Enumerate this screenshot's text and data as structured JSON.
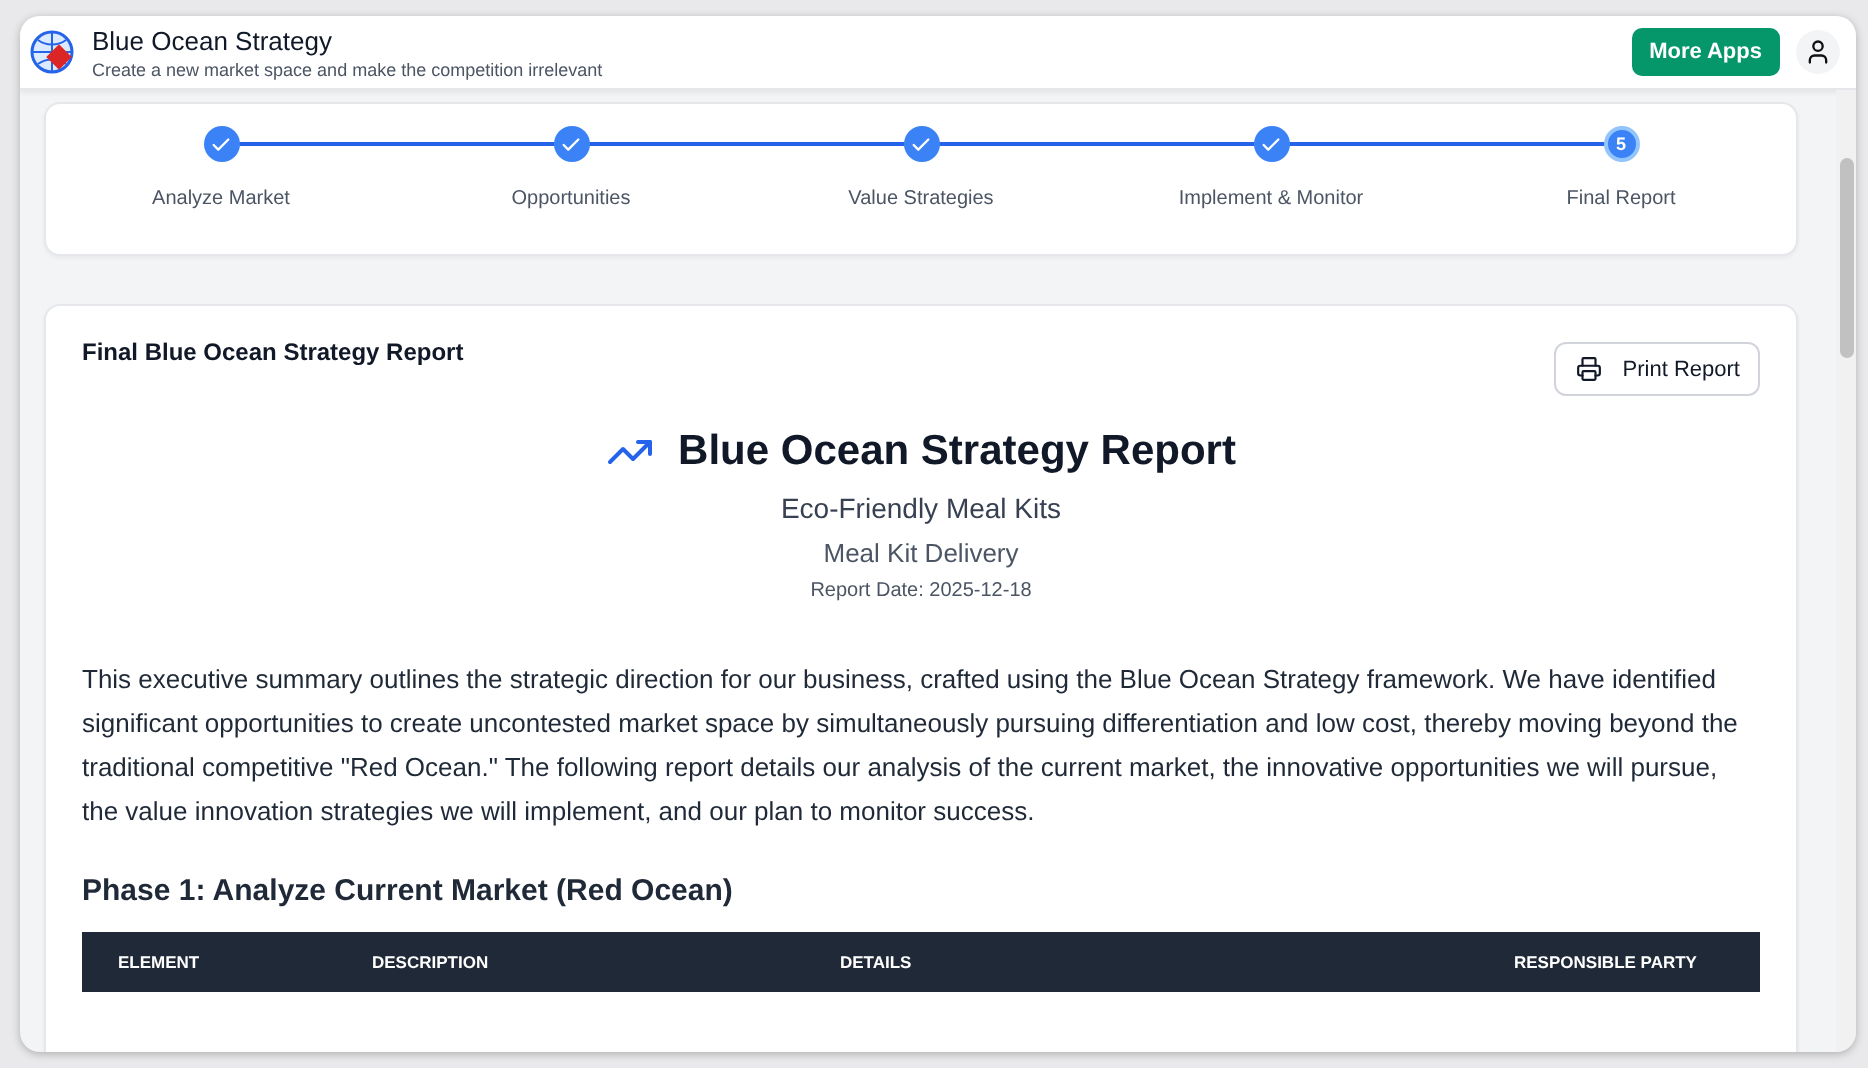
{
  "app": {
    "title": "Blue Ocean Strategy",
    "subtitle": "Create a new market space and make the competition irrelevant",
    "more_apps": "More Apps"
  },
  "steps": [
    {
      "label": "Analyze Market",
      "completed": true
    },
    {
      "label": "Opportunities",
      "completed": true
    },
    {
      "label": "Value Strategies",
      "completed": true
    },
    {
      "label": "Implement & Monitor",
      "completed": true
    },
    {
      "label": "Final Report",
      "completed": false,
      "number": "5"
    }
  ],
  "report": {
    "card_title": "Final Blue Ocean Strategy Report",
    "print_button": "Print Report",
    "title": "Blue Ocean Strategy Report",
    "product": "Eco-Friendly Meal Kits",
    "industry": "Meal Kit Delivery",
    "date": "Report Date: 2025-12-18",
    "summary": "This executive summary outlines the strategic direction for our business, crafted using the Blue Ocean Strategy framework. We have identified significant opportunities to create uncontested market space by simultaneously pursuing differentiation and low cost, thereby moving beyond the traditional competitive \"Red Ocean.\" The following report details our analysis of the current market, the innovative opportunities we will pursue, the value innovation strategies we will implement, and our plan to monitor success.",
    "phase_title": "Phase 1: Analyze Current Market (Red Ocean)",
    "table": {
      "columns": [
        "ELEMENT",
        "DESCRIPTION",
        "DETAILS",
        "RESPONSIBLE PARTY"
      ]
    }
  }
}
